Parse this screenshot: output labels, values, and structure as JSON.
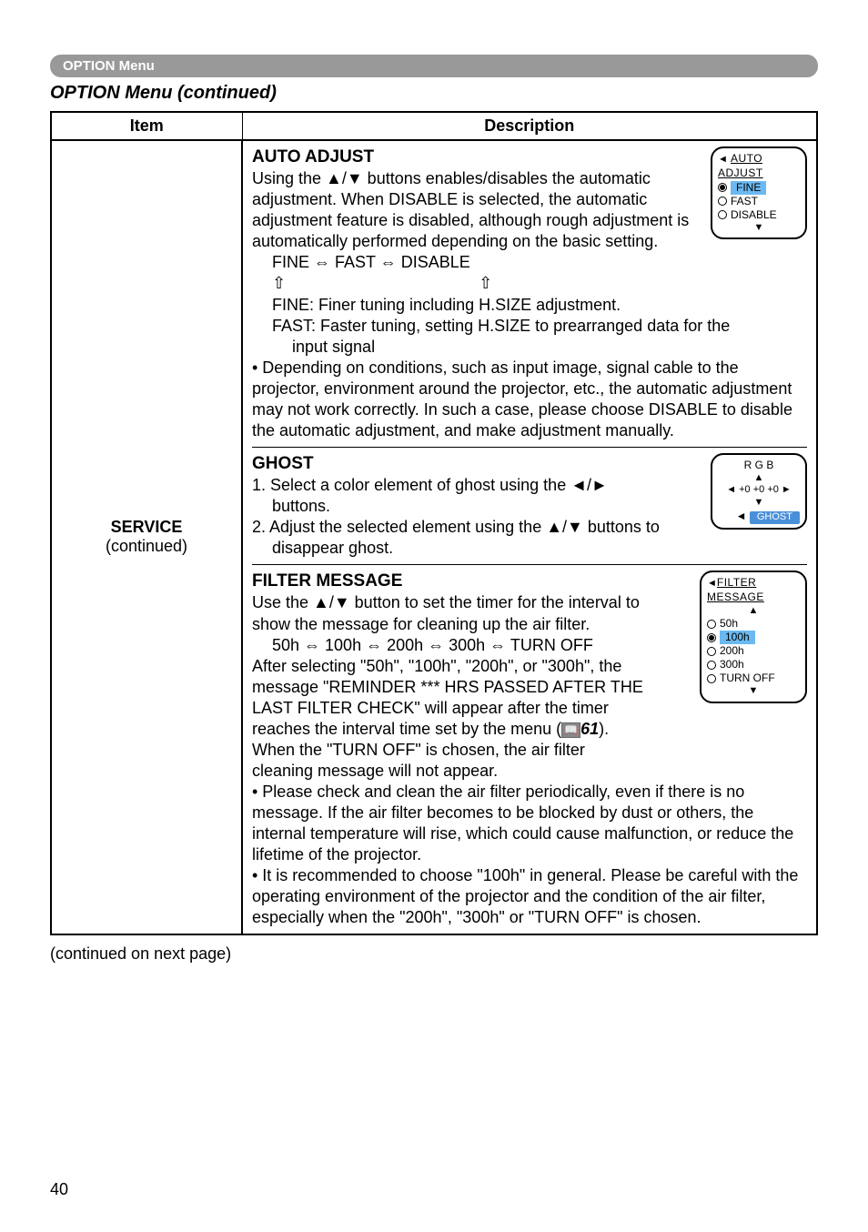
{
  "pill_header": "OPTION Menu",
  "section_title": "OPTION Menu (continued)",
  "th_item": "Item",
  "th_desc": "Description",
  "left_label_bold": "SERVICE",
  "left_label_sub": "(continued)",
  "auto_adjust": {
    "heading": "AUTO ADJUST",
    "p1": "Using the ▲/▼ buttons enables/disables the automatic adjustment. When DISABLE is selected, the automatic adjustment feature is disabled, although rough adjustment is automatically performed depending on the basic setting.",
    "cycle": "FINE ⇔ FAST ⇔ DISABLE",
    "arrows_row": "⇧                              ⇧",
    "fine_line": "FINE: Finer tuning including H.SIZE adjustment.",
    "fast_line_a": "FAST: Faster tuning, setting H.SIZE to prearranged data for the",
    "fast_line_b": "input signal",
    "bullet": "• Depending on conditions, such as input image, signal cable to the projector, environment around the projector, etc., the automatic adjustment may not work correctly.  In such a case, please choose DISABLE to disable the automatic adjustment, and make adjustment manually.",
    "box": {
      "title": "AUTO ADJUST",
      "opt1": "FINE",
      "opt2": "FAST",
      "opt3": "DISABLE"
    }
  },
  "ghost": {
    "heading": "GHOST",
    "l1": "1. Select a color element of ghost using the ◄/►",
    "l1b": "buttons.",
    "l2": "2. Adjust the selected element using the ▲/▼ buttons to",
    "l2b": "disappear ghost.",
    "box": {
      "rgb": "R   G   B",
      "vals": "◄ +0  +0 +0 ►",
      "label": "GHOST"
    }
  },
  "filter": {
    "heading": "FILTER MESSAGE",
    "p1a": "Use the ▲/▼ button to set the timer for the interval to",
    "p1b": "show the message for cleaning up the air filter.",
    "cycle": "50h ⇔ 100h ⇔ 200h ⇔ 300h ⇔ TURN OFF",
    "p2a": "After selecting \"50h\", \"100h\", \"200h\", or \"300h\", the",
    "p2b": "message \"REMINDER *** HRS PASSED AFTER THE",
    "p2c": "LAST FILTER CHECK\" will appear after the timer",
    "p2d_pre": "reaches the interval time set by the menu (",
    "p2d_ref": "61",
    "p2d_post": ").",
    "p2e": "When the \"TURN OFF\" is chosen, the air filter",
    "p2f": "cleaning message will not appear.",
    "bullet1": "• Please check and clean the air filter periodically, even if there is no message. If the air filter becomes to be blocked by dust or others, the internal temperature will rise, which could cause malfunction, or reduce the lifetime of the projector.",
    "bullet2": "• It is recommended to choose \"100h\" in general. Please be careful with the operating environment of the projector and the condition of the air filter, especially when the \"200h\", \"300h\" or \"TURN OFF\" is chosen.",
    "box": {
      "title": "FILTER MESSAGE",
      "o1": "50h",
      "o2": "100h",
      "o3": "200h",
      "o4": "300h",
      "o5": "TURN OFF"
    }
  },
  "cont_note": "(continued on next page)",
  "page_num": "40"
}
